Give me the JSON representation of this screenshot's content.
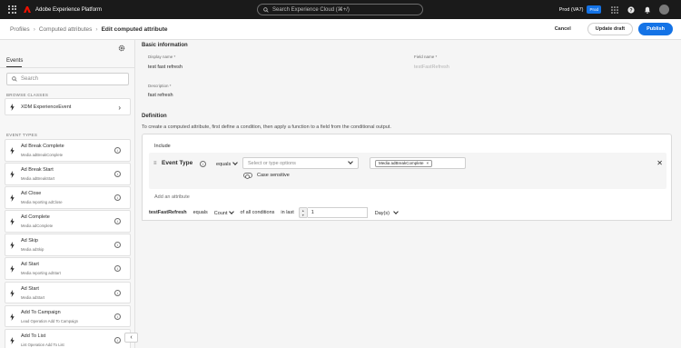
{
  "topbar": {
    "brand": "Adobe Experience Platform",
    "search_placeholder": "Search Experience Cloud (⌘+/)",
    "org": "Prod (VA7)",
    "badge": "Prod"
  },
  "breadcrumb": {
    "items": [
      "Profiles",
      "Computed attributes"
    ],
    "current": "Edit computed attribute"
  },
  "actions": {
    "cancel": "Cancel",
    "update_draft": "Update draft",
    "publish": "Publish"
  },
  "sidebar": {
    "tab": "Events",
    "search_placeholder": "Search",
    "browse_heading": "BROWSE CLASSES",
    "class_label": "XDM ExperienceEvent",
    "event_types_heading": "EVENT TYPES",
    "events": [
      {
        "name": "Ad Break Complete",
        "sub": "Media adBreakComplete"
      },
      {
        "name": "Ad Break Start",
        "sub": "Media adBreakStart"
      },
      {
        "name": "Ad Close",
        "sub": "Media reporting adClose"
      },
      {
        "name": "Ad Complete",
        "sub": "Media adComplete"
      },
      {
        "name": "Ad Skip",
        "sub": "Media adSkip"
      },
      {
        "name": "Ad Start",
        "sub": "Media reporting adStart"
      },
      {
        "name": "Ad Start",
        "sub": "Media adStart"
      },
      {
        "name": "Add To Campaign",
        "sub": "Lead Operation Add To Campaign"
      },
      {
        "name": "Add To List",
        "sub": "List Operation Add To List"
      }
    ]
  },
  "basic": {
    "title": "Basic information",
    "display_name_label": "Display name *",
    "display_name_value": "test fast refresh",
    "field_name_label": "Field name *",
    "field_name_value": "testFastRefresh",
    "description_label": "Description *",
    "description_value": "fast refresh"
  },
  "definition": {
    "title": "Definition",
    "description": "To create a computed attribute, first define a condition, then apply a function to a field from the conditional output.",
    "include_label": "Include",
    "event_type_label": "Event Type",
    "operator": "equals",
    "type_placeholder": "Select or type options",
    "case_sensitive": "Case sensitive",
    "tag_value": "Media adBreakComplete",
    "add_attribute": "Add an attribute"
  },
  "function": {
    "attribute": "testFastRefresh",
    "equals": "equals",
    "func": "Count",
    "of_all": "of all conditions",
    "in_last": "in last",
    "number": "1",
    "unit": "Day(s)"
  },
  "colors": {
    "accent": "#1473e6",
    "topbar": "#1a1a1a",
    "adobe_red": "#eb1000"
  }
}
